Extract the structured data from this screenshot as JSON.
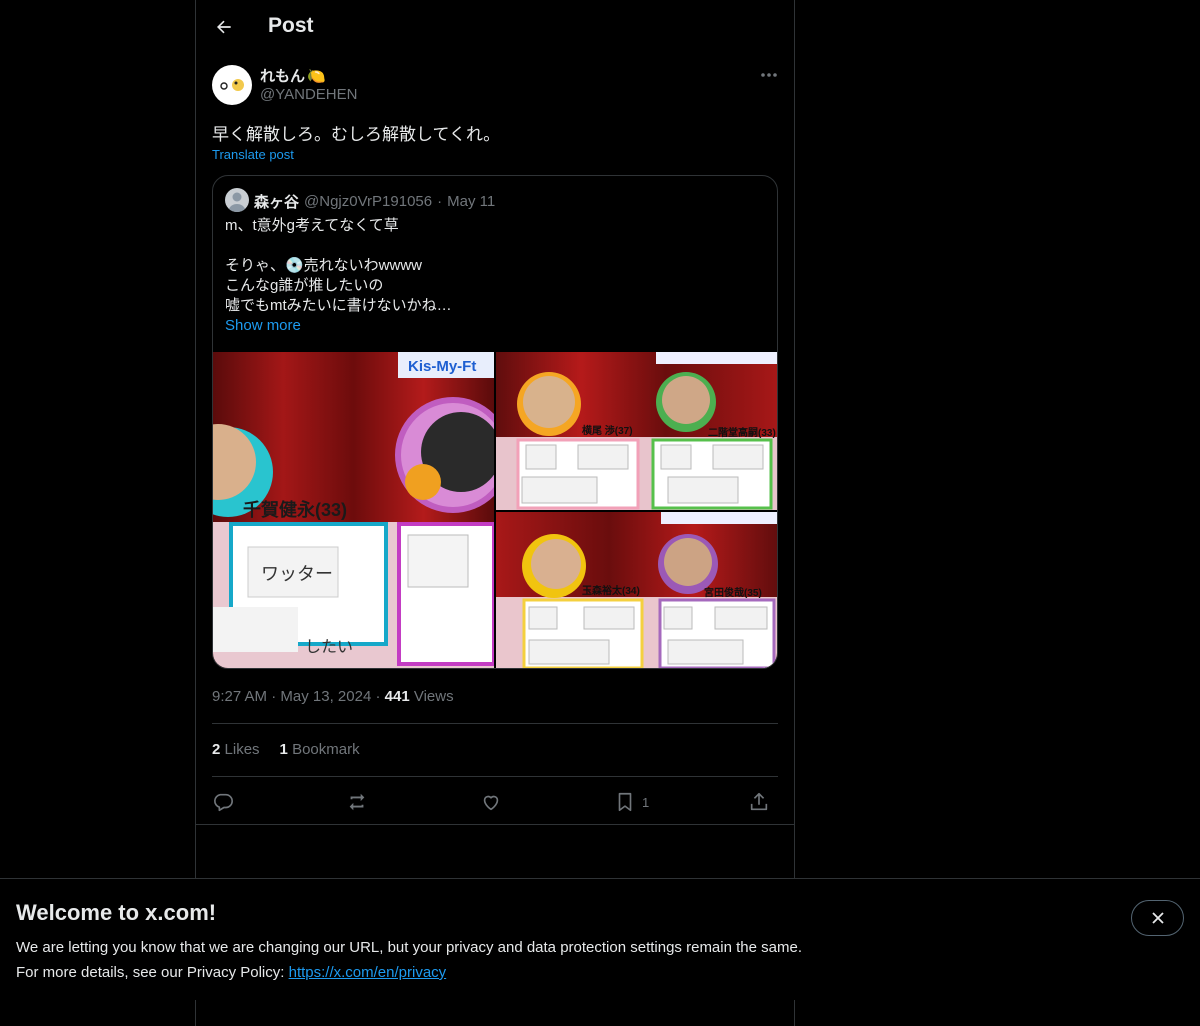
{
  "header": {
    "title": "Post"
  },
  "post": {
    "display_name": "れもん",
    "name_emoji": "🍋",
    "handle": "@YANDEHEN",
    "text": "早く解散しろ。むしろ解散してくれ。",
    "translate": "Translate post",
    "timestamp_time": "9:27 AM",
    "timestamp_date": "May 13, 2024",
    "views_count": "441",
    "views_label": "Views",
    "likes_count": "2",
    "likes_label": "Likes",
    "bookmarks_count": "1",
    "bookmarks_label": "Bookmark",
    "bookmark_action_count": "1"
  },
  "quote": {
    "display_name": "森ヶ谷",
    "handle": "@Ngjz0VrP191056",
    "separator": "·",
    "date": "May 11",
    "text": "m、t意外g考えてなくて草\n\nそりゃ、💿売れないわwwww\nこんなg誰が推したいの\n嘘でもmtみたいに書けないかね…",
    "show_more": "Show more",
    "media_labels": {
      "m1_top": "Kis-My-Ft",
      "m1_name": "千賀健永(33)",
      "m1_card": "ワッター",
      "m1_bottom": "したい",
      "m2_name1": "横尾 渉(37)",
      "m2_name2": "二階堂高嗣(33)",
      "m3_name1": "玉森裕太(34)",
      "m3_name2": "宮田俊哉(35)"
    }
  },
  "banner": {
    "title": "Welcome to x.com!",
    "line1": "We are letting you know that we are changing our URL, but your privacy and data protection settings remain the same.",
    "line2_prefix": "For more details, see our Privacy Policy:",
    "link": "https://x.com/en/privacy"
  },
  "icons": [
    "back-arrow-icon",
    "more-icon",
    "reply-icon",
    "repost-icon",
    "like-icon",
    "bookmark-icon",
    "share-icon",
    "close-icon"
  ]
}
